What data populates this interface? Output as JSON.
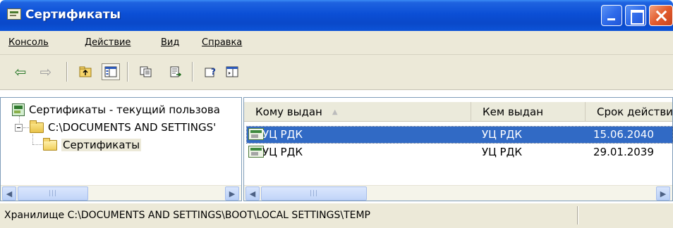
{
  "window": {
    "title": "Сертификаты"
  },
  "menu": {
    "items": [
      "Консоль",
      "Действие",
      "Вид",
      "Справка"
    ]
  },
  "toolbar": {
    "buttons": [
      "back",
      "forward",
      "up-one-level",
      "show-hide-console-tree",
      "copy",
      "export-list",
      "help",
      "show-hide-action-pane"
    ]
  },
  "tree": {
    "root_label": "Сертификаты - текущий пользова",
    "store_label": "C:\\DOCUMENTS AND SETTINGS'",
    "folder_label": "Сертификаты"
  },
  "list": {
    "columns": [
      "Кому выдан",
      "Кем выдан",
      "Срок действи"
    ],
    "sort_indicator": "▲",
    "rows": [
      {
        "issued_to": "УЦ РДК",
        "issued_by": "УЦ РДК",
        "expires": "15.06.2040",
        "selected": true
      },
      {
        "issued_to": "УЦ РДК",
        "issued_by": "УЦ РДК",
        "expires": "29.01.2039",
        "selected": false
      }
    ]
  },
  "status": {
    "text": "Хранилище C:\\DOCUMENTS AND SETTINGS\\BOOT\\LOCAL SETTINGS\\TEMP"
  },
  "colors": {
    "titlebar": "#0a48c9",
    "selection": "#316ac5",
    "chrome": "#ece9d8"
  }
}
